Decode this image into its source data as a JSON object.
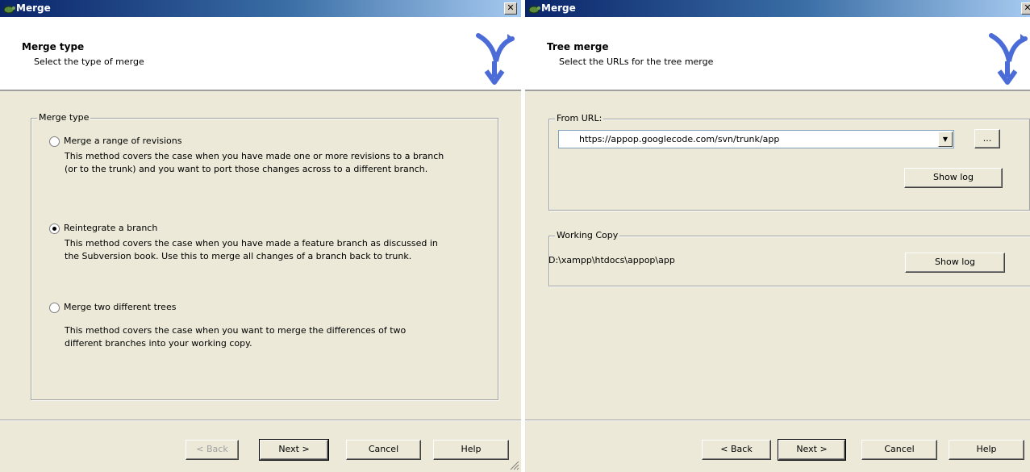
{
  "left_window": {
    "title": "Merge",
    "header_title": "Merge type",
    "header_subtitle": "Select the type of merge",
    "groupbox_label": "Merge type",
    "options": [
      {
        "label": "Merge a range of revisions",
        "selected": false,
        "description_line1": "This method covers the case when you have made one or more revisions to a branch",
        "description_line2": "(or to the trunk) and you want to port those changes across to a different branch."
      },
      {
        "label": "Reintegrate a branch",
        "selected": true,
        "description_line1": "This method covers the case when you have made a feature branch as discussed in",
        "description_line2": "the Subversion book. Use this to merge all changes of a branch back to trunk."
      },
      {
        "label": "Merge two different trees",
        "selected": false,
        "description_line1": "This method covers the case when you want to merge the differences of two",
        "description_line2": "different branches into your working copy."
      }
    ],
    "buttons": {
      "back": "< Back",
      "back_enabled": false,
      "next": "Next >",
      "cancel": "Cancel",
      "help": "Help"
    }
  },
  "right_window": {
    "title": "Merge",
    "header_title": "Tree merge",
    "header_subtitle": "Select the URLs for the tree merge",
    "from_url_label": "From URL:",
    "from_url_value": "https://appop.googlecode.com/svn/trunk/app",
    "browse_label": "...",
    "show_log_label": "Show log",
    "working_copy_label": "Working Copy",
    "working_copy_path": "D:\\xampp\\htdocs\\appop\\app",
    "working_copy_show_log": "Show log",
    "buttons": {
      "back": "< Back",
      "next": "Next >",
      "cancel": "Cancel",
      "help": "Help"
    }
  },
  "colors": {
    "title_bar_start": "#0a246a",
    "title_bar_end": "#a6caf0",
    "dialog_face": "#ece9d8",
    "logo_blue": "#4b6bd6"
  }
}
